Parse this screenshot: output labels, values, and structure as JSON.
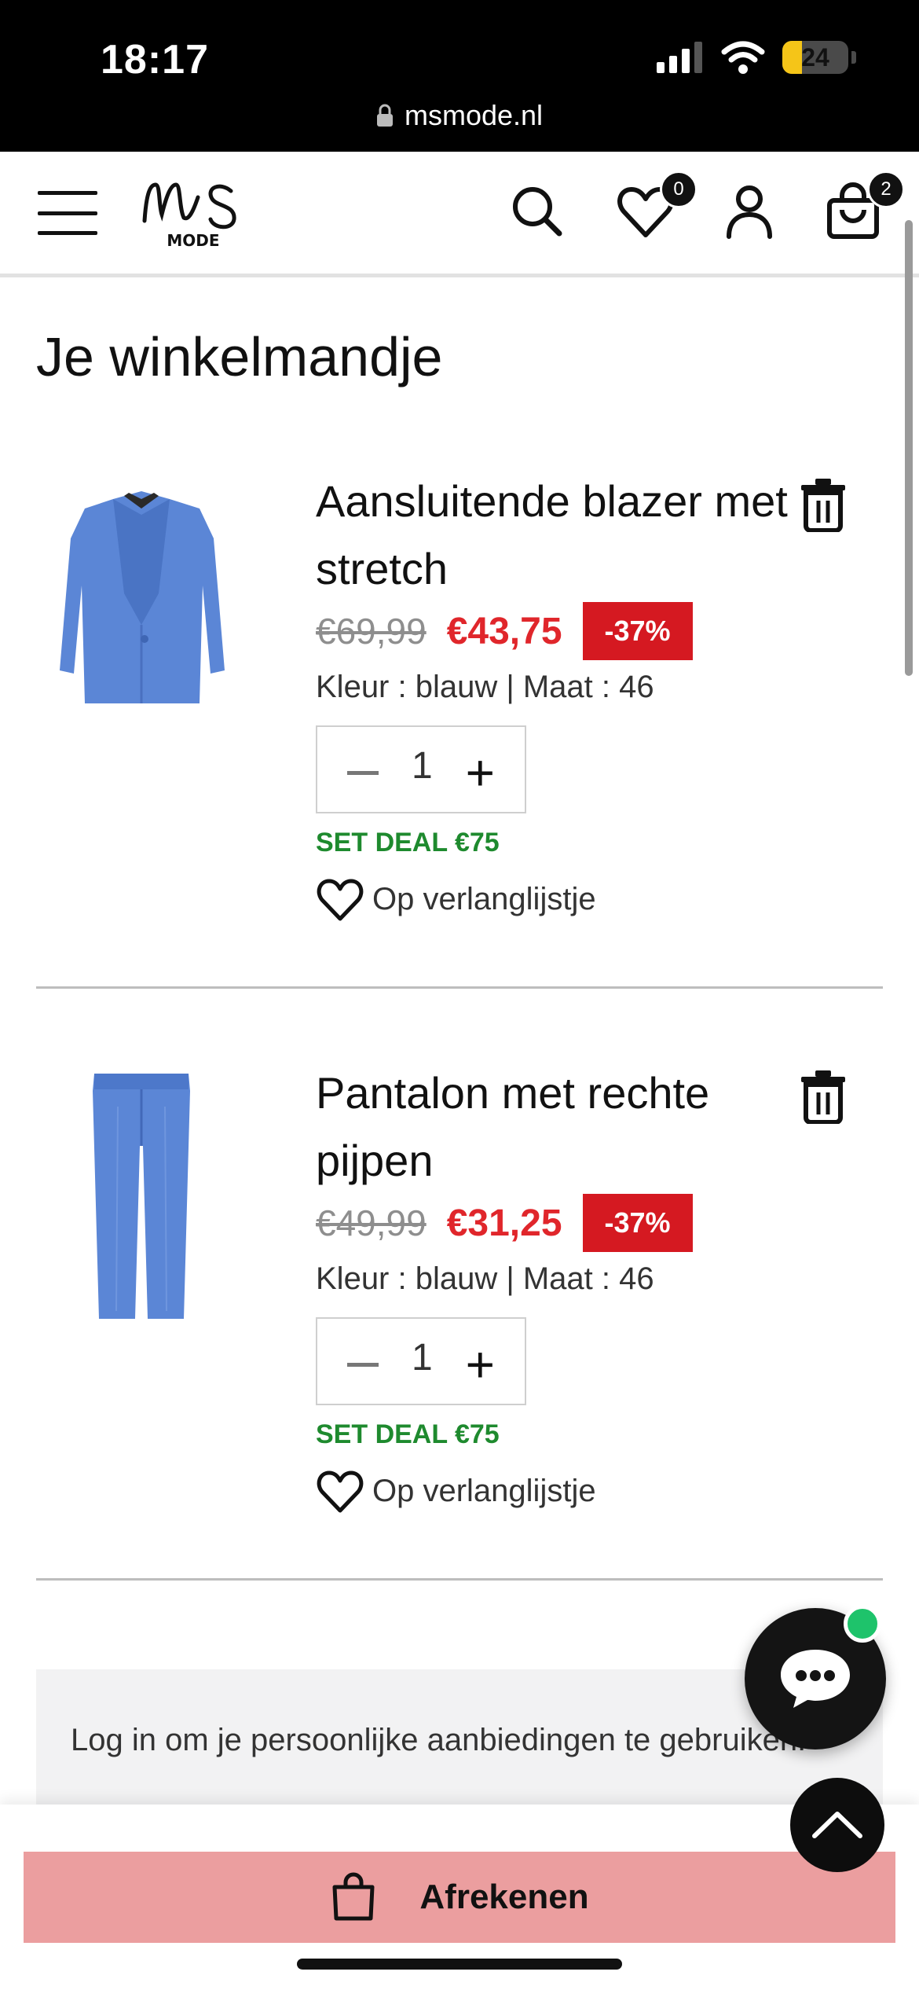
{
  "status_bar": {
    "time": "18:17",
    "battery": "24",
    "url": "msmode.nl"
  },
  "header": {
    "logo_text": "MS",
    "logo_sub": "MODE",
    "wishlist_count": "0",
    "cart_count": "2"
  },
  "page": {
    "title": "Je winkelmandje"
  },
  "cart": {
    "items": [
      {
        "name": "Aansluitende blazer met stretch",
        "old_price": "€69,99",
        "new_price": "€43,75",
        "discount": "-37%",
        "variant": "Kleur : blauw |  Maat : 46",
        "quantity": "1",
        "deal": "SET DEAL €75",
        "wishlist_label": "Op verlanglijstje",
        "image_color": "#5b86d6"
      },
      {
        "name": "Pantalon met rechte pijpen",
        "old_price": "€49,99",
        "new_price": "€31,25",
        "discount": "-37%",
        "variant": "Kleur : blauw |  Maat : 46",
        "quantity": "1",
        "deal": "SET DEAL €75",
        "wishlist_label": "Op verlanglijstje",
        "image_color": "#5b86d6"
      }
    ]
  },
  "login_box": {
    "text": "Log in om je persoonlijke aanbiedingen te gebruiken!"
  },
  "checkout": {
    "label": "Afrekenen"
  },
  "colors": {
    "accent_sale": "#e0262b",
    "discount_bg": "#d51921",
    "deal_green": "#1e8a2e",
    "checkout_bg": "#eb9e9f",
    "online_dot": "#1ec36b"
  },
  "icons": [
    "menu-icon",
    "search-icon",
    "heart-icon",
    "user-icon",
    "bag-icon",
    "trash-icon",
    "chat-icon",
    "arrow-up-icon",
    "lock-icon",
    "wifi-icon",
    "signal-icon",
    "battery-icon"
  ]
}
